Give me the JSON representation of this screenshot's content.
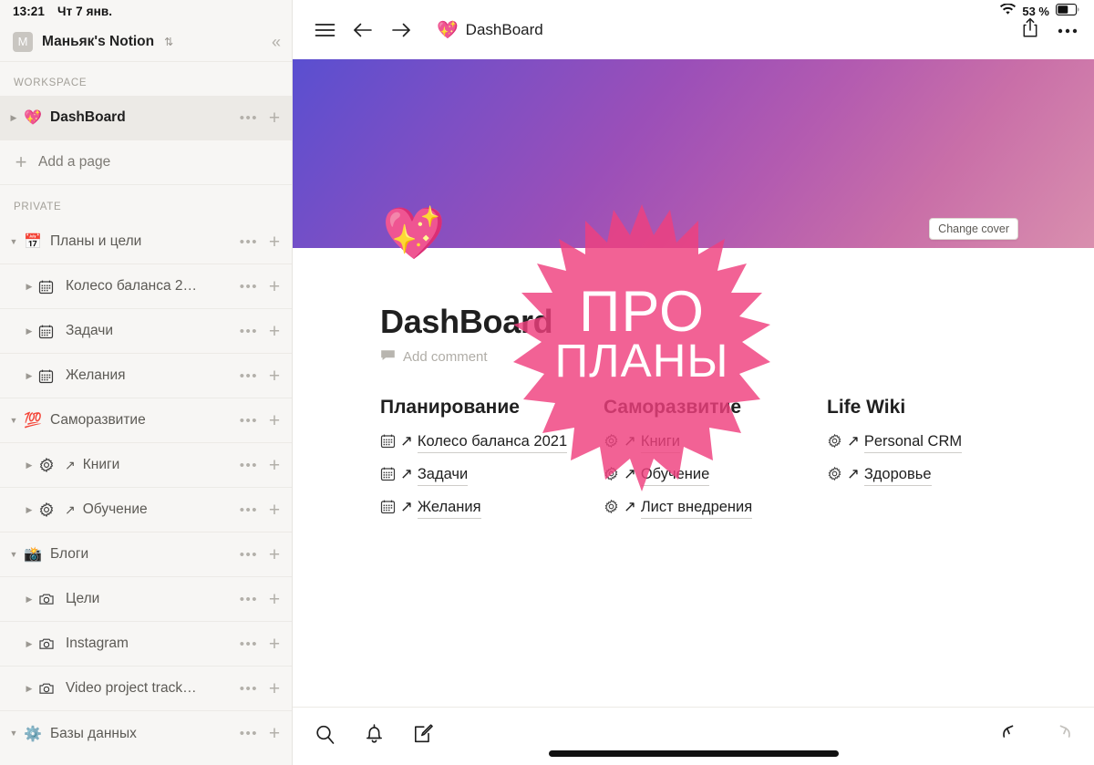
{
  "status_bar": {
    "time": "13:21",
    "date": "Чт 7 янв.",
    "battery_percent": "53 %",
    "wifi_icon": "wifi-icon",
    "battery_icon": "battery-icon"
  },
  "sidebar": {
    "workspace": {
      "avatar_letter": "M",
      "name": "Маньяк's Notion",
      "switch_icon": "chevron-updown-icon",
      "collapse_icon": "collapse-sidebar-icon"
    },
    "sections": [
      {
        "label": "WORKSPACE"
      },
      {
        "label": "PRIVATE"
      }
    ],
    "add_page_label": "Add a page",
    "workspace_items": [
      {
        "emoji": "💖",
        "label": "DashBoard",
        "active": true,
        "twisty": "collapsed",
        "icon": "sparkling-heart-icon"
      }
    ],
    "private_items": [
      {
        "icon": "calendar-17-icon",
        "emoji": "📅",
        "label": "Планы и цели",
        "twisty": "expanded",
        "indent": 0,
        "arrow": false
      },
      {
        "icon": "calendar-grid-icon",
        "emoji": "",
        "label": "Колесо баланса 2…",
        "twisty": "collapsed",
        "indent": 1,
        "arrow": false
      },
      {
        "icon": "calendar-grid-icon",
        "emoji": "",
        "label": "Задачи",
        "twisty": "collapsed",
        "indent": 1,
        "arrow": false
      },
      {
        "icon": "calendar-grid-icon",
        "emoji": "",
        "label": "Желания",
        "twisty": "collapsed",
        "indent": 1,
        "arrow": false
      },
      {
        "icon": "hundred-points-icon",
        "emoji": "💯",
        "label": "Саморазвитие",
        "twisty": "expanded",
        "indent": 0,
        "arrow": false
      },
      {
        "icon": "gear-icon",
        "emoji": "",
        "label": "Книги",
        "twisty": "collapsed",
        "indent": 1,
        "arrow": true
      },
      {
        "icon": "gear-icon",
        "emoji": "",
        "label": "Обучение",
        "twisty": "collapsed",
        "indent": 1,
        "arrow": true
      },
      {
        "icon": "camera-flash-icon",
        "emoji": "📸",
        "label": "Блоги",
        "twisty": "expanded",
        "indent": 0,
        "arrow": false
      },
      {
        "icon": "camera-icon",
        "emoji": "",
        "label": "Цели",
        "twisty": "collapsed",
        "indent": 1,
        "arrow": false
      },
      {
        "icon": "camera-icon",
        "emoji": "",
        "label": "Instagram",
        "twisty": "collapsed",
        "indent": 1,
        "arrow": false
      },
      {
        "icon": "camera-icon",
        "emoji": "",
        "label": "Video project track…",
        "twisty": "collapsed",
        "indent": 1,
        "arrow": false
      },
      {
        "icon": "gear-blue-icon",
        "emoji": "⚙️",
        "label": "Базы данных",
        "twisty": "expanded",
        "indent": 0,
        "arrow": false
      }
    ],
    "row_more_icon": "ellipsis-icon",
    "row_add_icon": "plus-icon"
  },
  "topbar": {
    "menu_icon": "hamburger-menu-icon",
    "back_icon": "arrow-left-icon",
    "forward_icon": "arrow-right-icon",
    "page_emoji": "💖",
    "page_title": "DashBoard",
    "share_icon": "share-icon",
    "more_icon": "ellipsis-icon"
  },
  "cover": {
    "change_cover_label": "Change cover",
    "gradient_from": "#5a4fd0",
    "gradient_to": "#d98fae"
  },
  "page": {
    "emoji": "💖",
    "title": "DashBoard",
    "add_comment_label": "Add comment",
    "comment_icon": "comment-icon"
  },
  "columns": [
    {
      "title": "Планирование",
      "items": [
        {
          "icon": "calendar-grid-icon",
          "arrow": "↗",
          "label": "Колесо баланса 2021"
        },
        {
          "icon": "calendar-grid-icon",
          "arrow": "↗",
          "label": "Задачи"
        },
        {
          "icon": "calendar-grid-icon",
          "arrow": "↗",
          "label": "Желания"
        }
      ]
    },
    {
      "title": "Саморазвитие",
      "items": [
        {
          "icon": "gear-icon",
          "arrow": "↗",
          "label": "Книги"
        },
        {
          "icon": "gear-icon",
          "arrow": "↗",
          "label": "Обучение"
        },
        {
          "icon": "gear-icon",
          "arrow": "↗",
          "label": "Лист внедрения"
        }
      ]
    },
    {
      "title": "Life Wiki",
      "items": [
        {
          "icon": "gear-icon",
          "arrow": "↗",
          "label": "Personal CRM"
        },
        {
          "icon": "gear-icon",
          "arrow": "↗",
          "label": "Здоровье"
        }
      ]
    }
  ],
  "overlay_badge": {
    "shape": "starburst",
    "color": "#ef3f7e",
    "opacity": 0.82,
    "line1": "ПРО",
    "line2": "ПЛАНЫ"
  },
  "bottombar": {
    "search_icon": "search-icon",
    "notifications_icon": "bell-icon",
    "new_page_icon": "compose-icon",
    "undo_icon": "undo-icon",
    "redo_icon": "redo-icon"
  }
}
